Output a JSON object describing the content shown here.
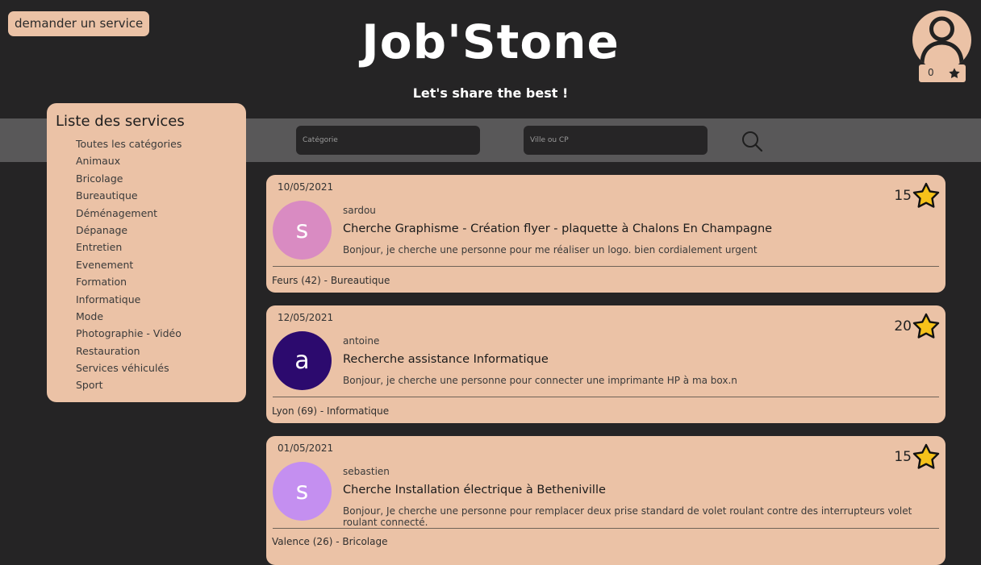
{
  "header": {
    "request_button": "demander un service",
    "logo": "Job'Stone",
    "tagline": "Let's share the best !",
    "user_score": "0"
  },
  "search": {
    "category_placeholder": "Catégorie",
    "city_placeholder": "Ville ou CP"
  },
  "sidebar": {
    "title": "Liste des services",
    "items": [
      "Toutes les catégories",
      "Animaux",
      "Bricolage",
      "Bureautique",
      "Déménagement",
      "Dépanage",
      "Entretien",
      "Evenement",
      "Formation",
      "Informatique",
      "Mode",
      "Photographie - Vidéo",
      "Restauration",
      "Services véhiculés",
      "Sport"
    ]
  },
  "posts": [
    {
      "date": "10/05/2021",
      "score": "15",
      "initial": "s",
      "user": "sardou",
      "title": "Cherche Graphisme - Création flyer - plaquette à Chalons En Champagne",
      "description": "Bonjour, je cherche une personne pour me réaliser un logo. bien cordialement urgent",
      "location": "Feurs (42) - Bureautique",
      "avatar_color": "#d98bc2"
    },
    {
      "date": "12/05/2021",
      "score": "20",
      "initial": "a",
      "user": "antoine",
      "title": "Recherche assistance Informatique",
      "description": "Bonjour, je cherche une personne pour connecter une imprimante HP à ma box.n",
      "location": "Lyon (69) - Informatique",
      "avatar_color": "#2c0a6e"
    },
    {
      "date": "01/05/2021",
      "score": "15",
      "initial": "s",
      "user": "sebastien",
      "title": "Cherche Installation électrique à Betheniville",
      "description": "Bonjour, Je cherche une personne pour remplacer deux prise standard de volet roulant contre des interrupteurs volet roulant connecté.",
      "location": "Valence (26) - Bricolage",
      "avatar_color": "#c48ff0"
    }
  ],
  "colors": {
    "background": "#252425",
    "accent": "#ebc2a6",
    "search_bar": "#595859",
    "star": "#f6c21a"
  },
  "icons": {
    "profile": "user-avatar-icon",
    "search": "search-icon",
    "rating": "star-icon"
  }
}
